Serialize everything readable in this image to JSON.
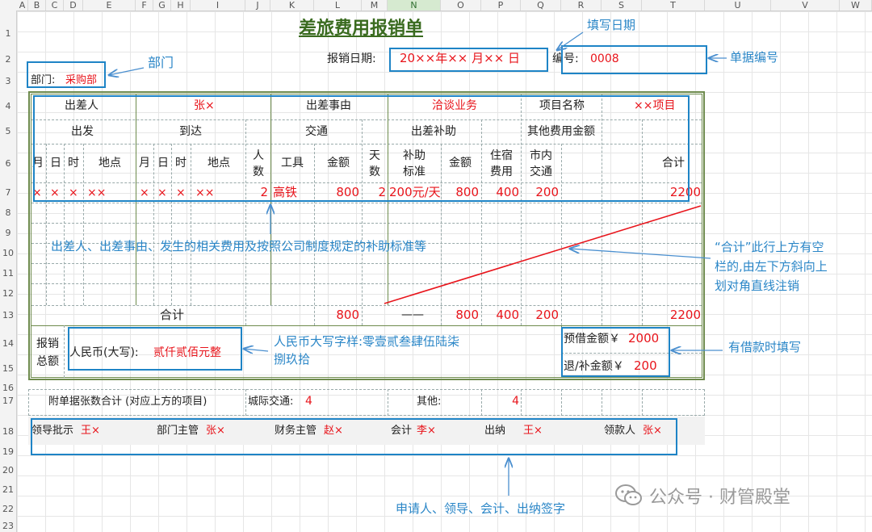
{
  "columns": [
    "A",
    "B",
    "C",
    "D",
    "E",
    "F",
    "G",
    "H",
    "I",
    "J",
    "K",
    "L",
    "M",
    "N",
    "O",
    "P",
    "Q",
    "R",
    "S",
    "T",
    "U",
    "V",
    "W"
  ],
  "rows": [
    "1",
    "2",
    "3",
    "4",
    "5",
    "6",
    "7",
    "8",
    "9",
    "10",
    "11",
    "12",
    "13",
    "14",
    "15",
    "16",
    "17",
    "18",
    "19",
    "20",
    "21",
    "22",
    "23"
  ],
  "form": {
    "title": "差旅费用报销单",
    "date_label": "报销日期:",
    "date_value": "20××年×× 月×× 日",
    "number_label": "编号:",
    "number_value": "0008",
    "dept_label": "部门:",
    "dept_value": "采购部",
    "traveler_label": "出差人",
    "traveler_value": "张×",
    "reason_label": "出差事由",
    "reason_value": "洽谈业务",
    "project_label": "项目名称",
    "project_value": "××项目",
    "depart_label": "出发",
    "arrive_label": "到达",
    "transport_label": "交通",
    "allowance_label": "出差补助",
    "other_label": "其他费用金额",
    "sub": {
      "month": "月",
      "day": "日",
      "hour": "时",
      "place": "地点",
      "people": "人\n数",
      "tool": "工具",
      "amount": "金额",
      "days": "天\n数",
      "std": "补助\n标准",
      "hotel": "住宿\n费用",
      "city": "市内\n交通",
      "total": "合计"
    },
    "row7": {
      "m1": "×",
      "d1": "×",
      "h1": "×",
      "p1": "××",
      "m2": "×",
      "d2": "×",
      "h2": "×",
      "p2": "××",
      "people": "2",
      "tool": "高铁",
      "tamount": "800",
      "days": "2",
      "std": "200元/天",
      "aamount": "800",
      "hotel": "400",
      "city": "200",
      "total": "2200"
    },
    "sum_label": "合计",
    "sum": {
      "tamount": "800",
      "dash": "——",
      "aamount": "800",
      "hotel": "400",
      "city": "200",
      "total": "2200"
    },
    "reimb_label": "报销\n总额",
    "rmb_label": "人民币(大写):",
    "rmb_value": "贰仟贰佰元整",
    "loan_label": "预借金额￥",
    "loan_value": "2000",
    "refund_label": "退/补金额￥",
    "refund_value": "200",
    "attach_label": "附单据张数合计 (对应上方的项目)",
    "intercity_label": "城际交通:",
    "intercity_value": "4",
    "others_label": "其他:",
    "others_value": "4",
    "signs": [
      {
        "label": "领导批示",
        "name": "王×"
      },
      {
        "label": "部门主管",
        "name": "张×"
      },
      {
        "label": "财务主管",
        "name": "赵×"
      },
      {
        "label": "会计",
        "name": "李×"
      },
      {
        "label": "出纳",
        "name": "王×"
      },
      {
        "label": "领款人",
        "name": "张×"
      }
    ]
  },
  "annotations": {
    "date": "填写日期",
    "dept": "部门",
    "number": "单据编号",
    "detail": "出差人、出差事由、发生的相关费用及按照公司制度规定的补助标准等",
    "diag": "“合计”此行上方有空\n栏的,由左下方斜向上\n划对角直线注销",
    "rmb": "人民币大写字样:零壹贰叁肆伍陆柒\n捌玖拾",
    "loan": "有借款时填写",
    "sign": "申请人、领导、会计、出纳签字"
  },
  "watermark": "公众号 · 财管殿堂",
  "colors": {
    "accent": "#1e84c6",
    "red": "#e8141b",
    "green_title": "#3a6b1f",
    "frame": "#6e8b4d"
  }
}
